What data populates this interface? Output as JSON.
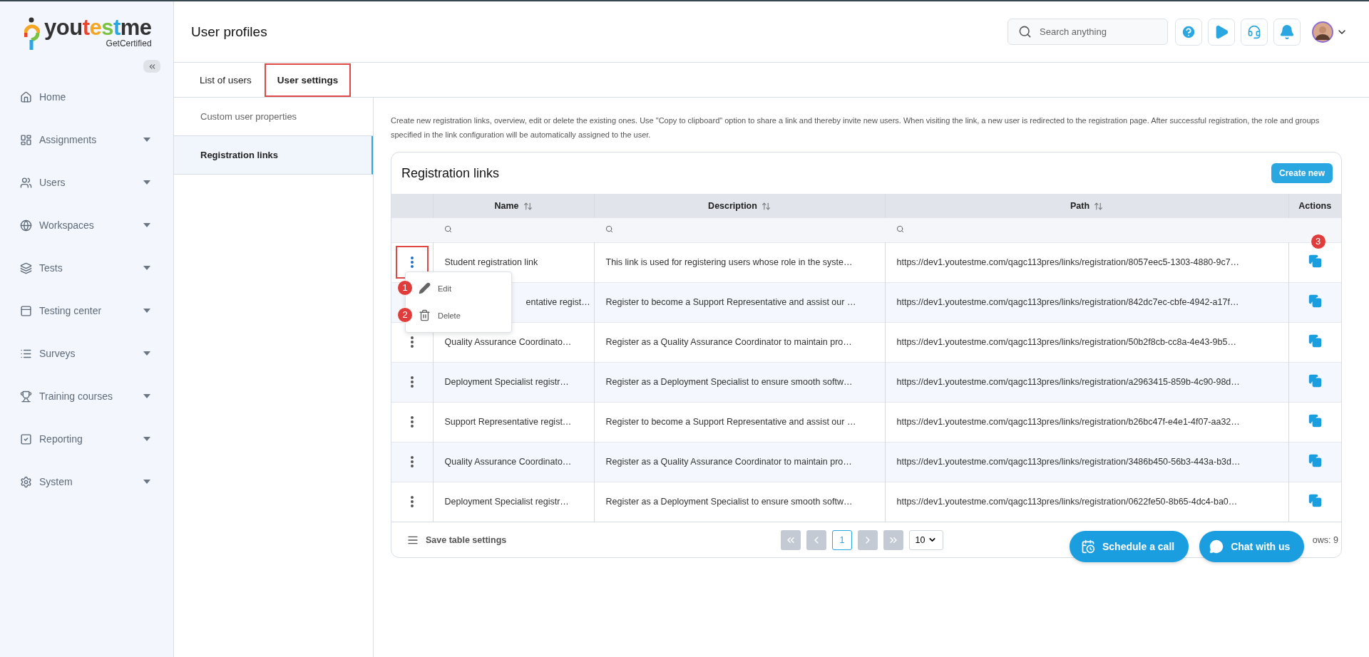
{
  "logo": {
    "text": "youtestme",
    "tagline": "GetCertified"
  },
  "sidebar": {
    "items": [
      {
        "label": "Home",
        "expandable": false
      },
      {
        "label": "Assignments",
        "expandable": true
      },
      {
        "label": "Users",
        "expandable": true
      },
      {
        "label": "Workspaces",
        "expandable": true
      },
      {
        "label": "Tests",
        "expandable": true
      },
      {
        "label": "Testing center",
        "expandable": true
      },
      {
        "label": "Surveys",
        "expandable": true
      },
      {
        "label": "Training courses",
        "expandable": true
      },
      {
        "label": "Reporting",
        "expandable": true
      },
      {
        "label": "System",
        "expandable": true
      }
    ]
  },
  "header": {
    "title": "User profiles",
    "search": {
      "placeholder": "Search anything"
    }
  },
  "tabs": [
    {
      "label": "List of users",
      "selected": false,
      "outlined": false
    },
    {
      "label": "User settings",
      "selected": true,
      "outlined": true
    }
  ],
  "subnav": [
    {
      "label": "Custom user properties",
      "selected": false
    },
    {
      "label": "Registration links",
      "selected": true
    }
  ],
  "description": "Create new registration links, overview, edit or delete the existing ones. Use \"Copy to clipboard\" option to share a link and thereby invite new users. When visiting the link, a new user is redirected to the registration page. After successful registration, the role and groups specified in the link configuration will be automatically assigned to the user.",
  "card": {
    "title": "Registration links",
    "create_button": "Create new"
  },
  "table": {
    "columns": [
      {
        "label": "Name",
        "sortable": true,
        "filter": true
      },
      {
        "label": "Description",
        "sortable": true,
        "filter": true
      },
      {
        "label": "Path",
        "sortable": true,
        "filter": true
      },
      {
        "label": "Actions",
        "sortable": false,
        "filter": false
      }
    ],
    "rows": [
      {
        "name": "Student registration link",
        "description": "This link is used for registering users whose role in the syste…",
        "path": "https://dev1.youtestme.com/qagc113pres/links/registration/8057eec5-1303-4880-9c7…",
        "menu_open": true,
        "kebab_outlined": true,
        "copy_badge": "3"
      },
      {
        "name": "entative regist…",
        "description": "Register to become a Support Representative and assist our …",
        "path": "https://dev1.youtestme.com/qagc113pres/links/registration/842dc7ec-cbfe-4942-a17f…"
      },
      {
        "name": "Quality Assurance Coordinato…",
        "description": "Register as a Quality Assurance Coordinator to maintain pro…",
        "path": "https://dev1.youtestme.com/qagc113pres/links/registration/50b2f8cb-cc8a-4e43-9b5…",
        "menu_open": false,
        "kebab_outlined": false
      },
      {
        "name": "Deployment Specialist registr…",
        "description": "Register as a Deployment Specialist to ensure smooth softw…",
        "path": "https://dev1.youtestme.com/qagc113pres/links/registration/a2963415-859b-4c90-98d…",
        "menu_open": false,
        "kebab_outlined": false
      },
      {
        "name": "Support Representative regist…",
        "description": "Register to become a Support Representative and assist our …",
        "path": "https://dev1.youtestme.com/qagc113pres/links/registration/b26bc47f-e4e1-4f07-aa32…",
        "menu_open": false,
        "kebab_outlined": false
      },
      {
        "name": "Quality Assurance Coordinato…",
        "description": "Register as a Quality Assurance Coordinator to maintain pro…",
        "path": "https://dev1.youtestme.com/qagc113pres/links/registration/3486b450-56b3-443a-b3d…",
        "menu_open": false,
        "kebab_outlined": false
      },
      {
        "name": "Deployment Specialist registr…",
        "description": "Register as a Deployment Specialist to ensure smooth softw…",
        "path": "https://dev1.youtestme.com/qagc113pres/links/registration/0622fe50-8b65-4dc4-ba0…",
        "menu_open": false,
        "kebab_outlined": false
      }
    ],
    "row_menu": [
      {
        "label": "Edit",
        "kind": "edit",
        "badge": "1"
      },
      {
        "label": "Delete",
        "kind": "delete",
        "badge": "2"
      }
    ],
    "footer": {
      "save_settings": "Save table settings",
      "current_page": "1",
      "page_size": "10",
      "rows_count": "ows: 9"
    }
  },
  "floating": [
    {
      "label": "Schedule a call",
      "kind": "schedule"
    },
    {
      "label": "Chat with us",
      "kind": "chat"
    }
  ]
}
